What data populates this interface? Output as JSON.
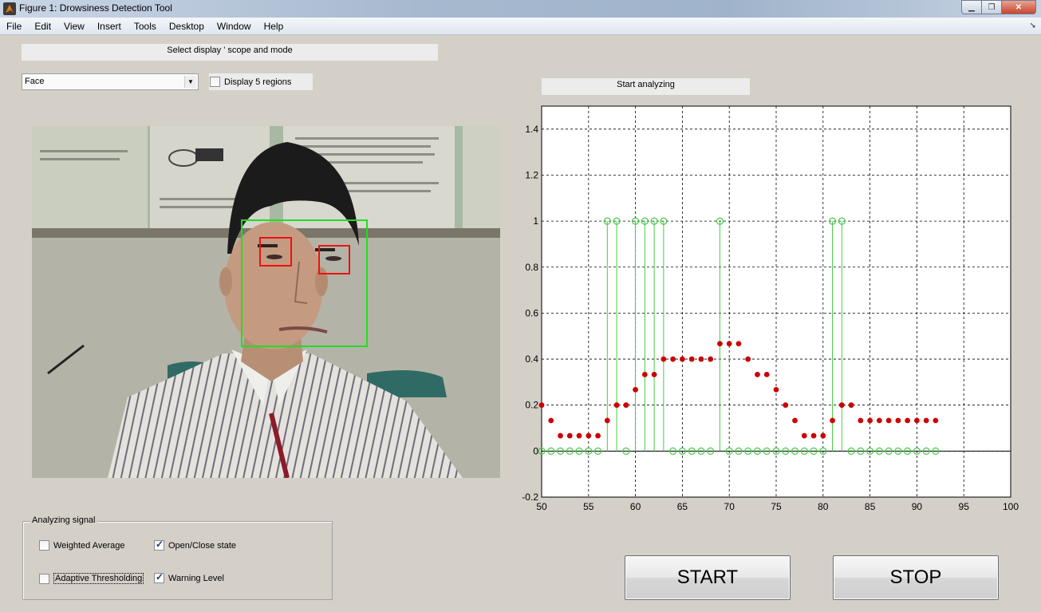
{
  "window": {
    "title": "Figure 1: Drowsiness Detection Tool"
  },
  "menu": [
    "File",
    "Edit",
    "View",
    "Insert",
    "Tools",
    "Desktop",
    "Window",
    "Help"
  ],
  "scope_label": "Select display ' scope and mode",
  "dropdown": {
    "selected": "Face"
  },
  "display_regions": {
    "label": "Display 5 regions",
    "checked": false
  },
  "analyze_label": "Start analyzing",
  "signal_group": {
    "title": "Analyzing signal",
    "options": [
      {
        "label": "Weighted Average",
        "checked": false
      },
      {
        "label": "Open/Close state",
        "checked": true
      },
      {
        "label": "Adaptive Thresholding",
        "checked": false
      },
      {
        "label": "Warning Level",
        "checked": true
      }
    ]
  },
  "buttons": {
    "start": "START",
    "stop": "STOP"
  },
  "colors": {
    "state_series": "#44cc44",
    "warning_series": "#cc0000",
    "face_box": "#22dd22",
    "eye_box": "#ee1111"
  },
  "chart_data": {
    "type": "scatter",
    "xlim": [
      50,
      100
    ],
    "ylim": [
      -0.2,
      1.5
    ],
    "xticks": [
      "50",
      "55",
      "60",
      "65",
      "70",
      "75",
      "80",
      "85",
      "90",
      "95",
      "100"
    ],
    "yticks": [
      "-0.2",
      "0",
      "0.2",
      "0.4",
      "0.6",
      "0.8",
      "1",
      "1.2",
      "1.4"
    ],
    "grid": true,
    "x": [
      50,
      51,
      52,
      53,
      54,
      55,
      56,
      57,
      58,
      59,
      60,
      61,
      62,
      63,
      64,
      65,
      66,
      67,
      68,
      69,
      70,
      71,
      72,
      73,
      74,
      75,
      76,
      77,
      78,
      79,
      80,
      81,
      82,
      83,
      84,
      85,
      86,
      87,
      88,
      89,
      90,
      91,
      92
    ],
    "series": [
      {
        "marker": "open-circle-stem",
        "values": [
          0,
          0,
          0,
          0,
          0,
          0,
          0,
          1,
          1,
          0,
          1,
          1,
          1,
          1,
          0,
          0,
          0,
          0,
          0,
          1,
          0,
          0,
          0,
          0,
          0,
          0,
          0,
          0,
          0,
          0,
          0,
          1,
          1,
          0,
          0,
          0,
          0,
          0,
          0,
          0,
          0,
          0,
          0
        ]
      },
      {
        "marker": "filled-dot",
        "values": [
          0.2,
          0.133,
          0.067,
          0.067,
          0.067,
          0.067,
          0.067,
          0.133,
          0.2,
          0.2,
          0.267,
          0.333,
          0.333,
          0.4,
          0.4,
          0.4,
          0.4,
          0.4,
          0.4,
          0.467,
          0.467,
          0.467,
          0.4,
          0.333,
          0.333,
          0.267,
          0.2,
          0.133,
          0.067,
          0.067,
          0.067,
          0.133,
          0.2,
          0.2,
          0.133,
          0.133,
          0.133,
          0.133,
          0.133,
          0.133,
          0.133,
          0.133,
          0.133
        ]
      }
    ]
  }
}
